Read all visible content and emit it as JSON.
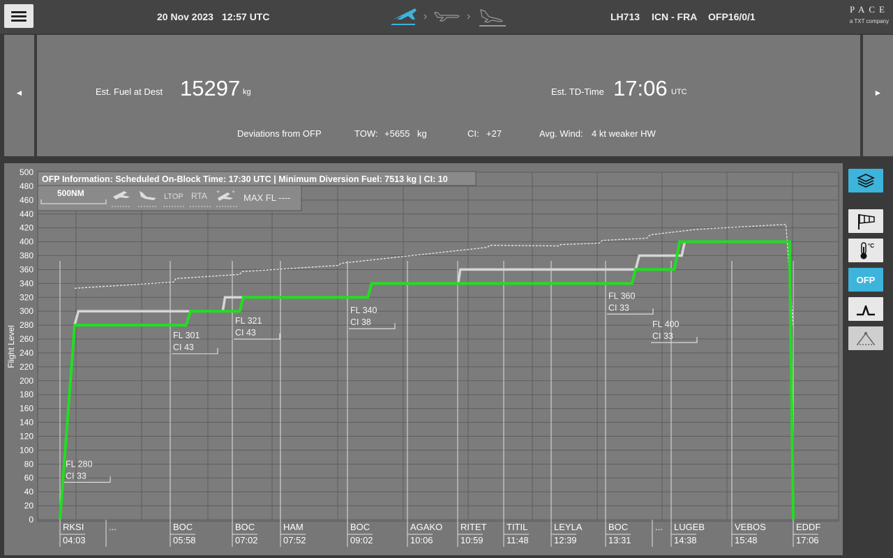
{
  "header": {
    "date": "20 Nov 2023",
    "time": "12:57 UTC",
    "flight": "LH713",
    "route": "ICN - FRA",
    "ofp": "OFP16/0/1",
    "logo_main": "PACE",
    "logo_sub": "a TXT company",
    "colors": {
      "phase_active": "#3db4dc",
      "phase_inactive": "#9a9a9a"
    },
    "phase_icons": [
      "takeoff-icon",
      "cruise-icon",
      "landing-icon"
    ]
  },
  "summary": {
    "fuel_label": "Est. Fuel at Dest",
    "fuel_value": "15297",
    "fuel_unit": "kg",
    "td_label": "Est. TD-Time",
    "td_value": "17:06",
    "td_unit": "UTC",
    "deviations_label": "Deviations from OFP",
    "tow_label": "TOW:",
    "tow_value": "+5655",
    "tow_unit": "kg",
    "ci_label": "CI:",
    "ci_value": "+27",
    "wind_label": "Avg. Wind:",
    "wind_value": "4 kt weaker HW",
    "nav_prev": "◄",
    "nav_next": "►"
  },
  "chart_info": {
    "ofp_info": "OFP Information: Scheduled On-Block Time: 17:30 UTC | Minimum Diversion Fuel: 7513 kg | CI: 10",
    "range_label": "500NM",
    "ltop": "LTOP",
    "rta": "RTA",
    "max_fl": "MAX FL ----"
  },
  "sidebar": {
    "buttons": [
      {
        "name": "layers-button",
        "icon": "layers-icon",
        "active": true
      },
      {
        "name": "wind-button",
        "icon": "windsock-icon",
        "active": false
      },
      {
        "name": "temperature-button",
        "icon": "thermometer-icon",
        "active": false
      },
      {
        "name": "ofp-button",
        "label": "OFP",
        "active": true
      },
      {
        "name": "profile-button",
        "icon": "terrain-profile-icon",
        "active": false
      },
      {
        "name": "cone-button",
        "icon": "cone-icon",
        "active": false
      }
    ]
  },
  "chart_data": {
    "type": "line",
    "ylabel": "Flight Level",
    "ylim": [
      0,
      500
    ],
    "yticks": [
      0,
      20,
      40,
      60,
      80,
      100,
      120,
      140,
      160,
      180,
      200,
      220,
      240,
      260,
      280,
      300,
      320,
      340,
      360,
      380,
      400,
      420,
      440,
      460,
      480,
      500
    ],
    "colors": {
      "planned": "#d0d0d0",
      "optimized": "#22dd22",
      "max_fl": "#e6e6e6"
    },
    "waypoints": [
      {
        "name": "RKSI",
        "time": "04:03"
      },
      {
        "name": "...",
        "time": ""
      },
      {
        "name": "BOC",
        "time": "05:58"
      },
      {
        "name": "BOC",
        "time": "07:02"
      },
      {
        "name": "HAM",
        "time": "07:52"
      },
      {
        "name": "BOC",
        "time": "09:02"
      },
      {
        "name": "AGAKO",
        "time": "10:06"
      },
      {
        "name": "RITET",
        "time": "10:59"
      },
      {
        "name": "TITIL",
        "time": "11:48"
      },
      {
        "name": "LEYLA",
        "time": "12:39"
      },
      {
        "name": "BOC",
        "time": "13:31"
      },
      {
        "name": "...",
        "time": ""
      },
      {
        "name": "LUGEB",
        "time": "14:38"
      },
      {
        "name": "VEBOS",
        "time": "15:48"
      },
      {
        "name": "EDDF",
        "time": "17:06"
      }
    ],
    "step_labels": [
      {
        "fl": "FL 280",
        "ci": "CI 33"
      },
      {
        "fl": "FL 301",
        "ci": "CI 43"
      },
      {
        "fl": "FL 321",
        "ci": "CI 43"
      },
      {
        "fl": "FL 340",
        "ci": "CI 38"
      },
      {
        "fl": "FL 360",
        "ci": "CI 33"
      },
      {
        "fl": "FL 400",
        "ci": "CI 33"
      }
    ],
    "series": [
      {
        "id": "optimized",
        "points": [
          [
            0,
            0
          ],
          [
            0.02,
            280
          ],
          [
            0.172,
            280
          ],
          [
            0.178,
            300
          ],
          [
            0.245,
            300
          ],
          [
            0.25,
            320
          ],
          [
            0.42,
            320
          ],
          [
            0.425,
            340
          ],
          [
            0.78,
            340
          ],
          [
            0.785,
            360
          ],
          [
            0.838,
            360
          ],
          [
            0.845,
            400
          ],
          [
            0.995,
            400
          ],
          [
            1,
            0
          ]
        ]
      },
      {
        "id": "planned",
        "points": [
          [
            0.02,
            280
          ],
          [
            0.025,
            300
          ],
          [
            0.172,
            300
          ],
          [
            0.222,
            300
          ],
          [
            0.225,
            320
          ],
          [
            0.25,
            320
          ],
          [
            0.42,
            320
          ],
          [
            0.425,
            340
          ],
          [
            0.543,
            340
          ],
          [
            0.546,
            360
          ],
          [
            0.785,
            360
          ],
          [
            0.79,
            380
          ],
          [
            0.848,
            380
          ],
          [
            0.852,
            400
          ],
          [
            0.995,
            400
          ]
        ]
      },
      {
        "id": "max_fl",
        "points": [
          [
            0.02,
            333
          ],
          [
            0.155,
            342
          ],
          [
            0.158,
            347
          ],
          [
            0.245,
            353
          ],
          [
            0.248,
            357
          ],
          [
            0.38,
            366
          ],
          [
            0.383,
            369
          ],
          [
            0.583,
            392
          ],
          [
            0.586,
            395
          ],
          [
            0.68,
            394
          ],
          [
            0.683,
            396
          ],
          [
            0.735,
            398
          ],
          [
            0.74,
            402
          ],
          [
            0.8,
            405
          ],
          [
            0.805,
            410
          ],
          [
            0.87,
            418
          ],
          [
            0.99,
            425
          ],
          [
            1,
            277
          ]
        ]
      }
    ]
  }
}
